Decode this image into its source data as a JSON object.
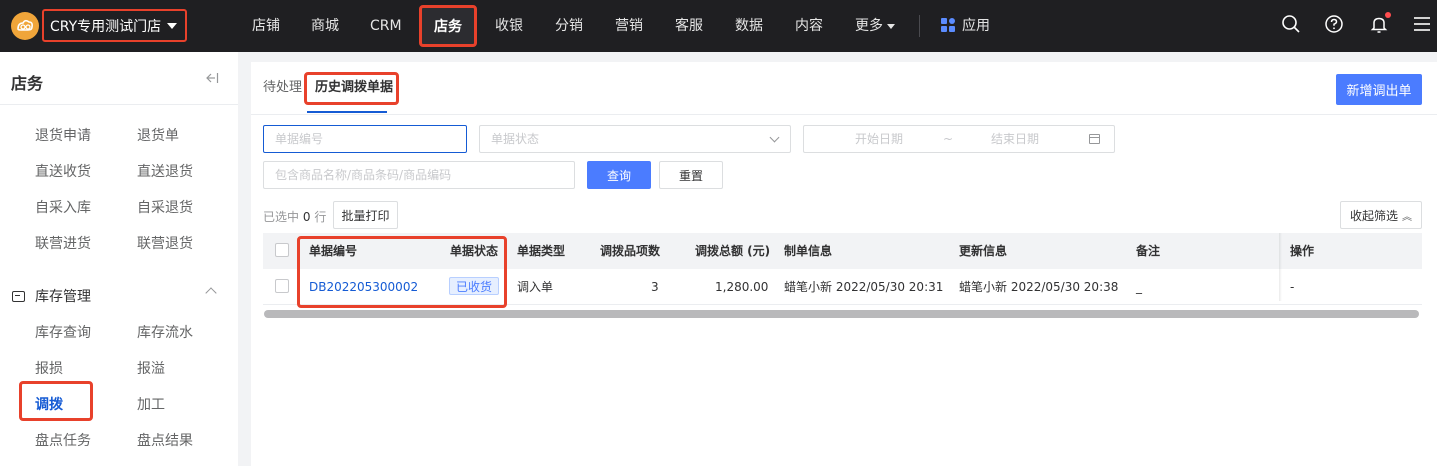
{
  "topbar": {
    "store_name": "CRY专用测试门店",
    "nav": [
      {
        "label": "店铺"
      },
      {
        "label": "商城"
      },
      {
        "label": "CRM"
      },
      {
        "label": "店务"
      },
      {
        "label": "收银"
      },
      {
        "label": "分销"
      },
      {
        "label": "营销"
      },
      {
        "label": "客服"
      },
      {
        "label": "数据"
      },
      {
        "label": "内容"
      },
      {
        "label": "更多"
      }
    ],
    "app_label": "应用",
    "active_nav": "店务",
    "accent_color": "#e8412b"
  },
  "sidebar": {
    "title": "店务",
    "items_top": [
      {
        "label": "退货申请"
      },
      {
        "label": "退货单"
      },
      {
        "label": "直送收货"
      },
      {
        "label": "直送退货"
      },
      {
        "label": "自采入库"
      },
      {
        "label": "自采退货"
      },
      {
        "label": "联营进货"
      },
      {
        "label": "联营退货"
      }
    ],
    "group": {
      "label": "库存管理",
      "items": [
        {
          "label": "库存查询"
        },
        {
          "label": "库存流水"
        },
        {
          "label": "报损"
        },
        {
          "label": "报溢"
        },
        {
          "label": "调拨"
        },
        {
          "label": "加工"
        },
        {
          "label": "盘点任务"
        },
        {
          "label": "盘点结果"
        }
      ]
    },
    "active_item": "调拨"
  },
  "main": {
    "tabs": [
      {
        "label": "待处理"
      },
      {
        "label": "历史调拨单据"
      }
    ],
    "new_button": "新增调出单",
    "filters": {
      "doc_no_placeholder": "单据编号",
      "status_placeholder": "单据状态",
      "start_date_placeholder": "开始日期",
      "date_sep": "~",
      "end_date_placeholder": "结束日期",
      "goods_placeholder": "包含商品名称/商品条码/商品编码",
      "query_button": "查询",
      "reset_button": "重置",
      "collapse_filter_button": "收起筛选"
    },
    "selected": {
      "prefix": "已选中",
      "count": "0",
      "suffix": "行"
    },
    "batch_print_button": "批量打印",
    "table": {
      "columns": [
        "单据编号",
        "单据状态",
        "单据类型",
        "调拨品项数",
        "调拨总额 (元)",
        "制单信息",
        "更新信息",
        "备注",
        "操作"
      ],
      "rows": [
        {
          "doc_no": "DB202205300002",
          "status": "已收货",
          "type": "调入单",
          "item_count": "3",
          "total": "1,280.00",
          "created": "蜡笔小新 2022/05/30 20:31",
          "updated": "蜡笔小新 2022/05/30 20:38",
          "remark": "_",
          "action": "-"
        }
      ]
    }
  }
}
